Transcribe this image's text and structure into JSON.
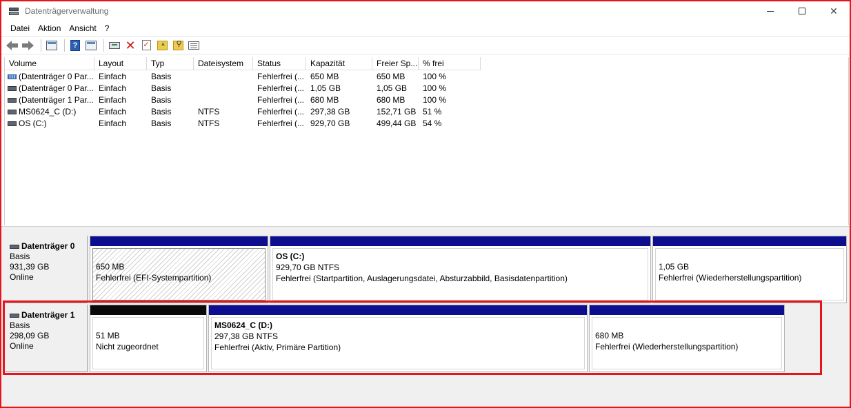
{
  "window": {
    "title": "Datenträgerverwaltung",
    "controls": {
      "minimize": "minimize",
      "maximize": "maximize",
      "close": "✕"
    }
  },
  "menu": [
    "Datei",
    "Aktion",
    "Ansicht",
    "?"
  ],
  "toolbar": {
    "icons": [
      "back-arrow-icon",
      "forward-arrow-icon",
      "console-tree-icon",
      "help-icon",
      "properties-icon",
      "connect-icon",
      "delete-icon",
      "check-icon",
      "folder-up-icon",
      "folder-search-icon",
      "list-view-icon"
    ]
  },
  "volume_list": {
    "columns": [
      "Volume",
      "Layout",
      "Typ",
      "Dateisystem",
      "Status",
      "Kapazität",
      "Freier Sp...",
      "% frei"
    ],
    "rows": [
      {
        "volume": "(Datenträger 0 Par...",
        "layout": "Einfach",
        "typ": "Basis",
        "dateisystem": "",
        "status": "Fehlerfrei (...",
        "kapazitaet": "650 MB",
        "frei": "650 MB",
        "prozent": "100 %",
        "icon": "striped"
      },
      {
        "volume": "(Datenträger 0 Par...",
        "layout": "Einfach",
        "typ": "Basis",
        "dateisystem": "",
        "status": "Fehlerfrei (...",
        "kapazitaet": "1,05 GB",
        "frei": "1,05 GB",
        "prozent": "100 %",
        "icon": "plain"
      },
      {
        "volume": "(Datenträger 1 Par...",
        "layout": "Einfach",
        "typ": "Basis",
        "dateisystem": "",
        "status": "Fehlerfrei (...",
        "kapazitaet": "680 MB",
        "frei": "680 MB",
        "prozent": "100 %",
        "icon": "plain"
      },
      {
        "volume": "MS0624_C (D:)",
        "layout": "Einfach",
        "typ": "Basis",
        "dateisystem": "NTFS",
        "status": "Fehlerfrei (...",
        "kapazitaet": "297,38 GB",
        "frei": "152,71 GB",
        "prozent": "51 %",
        "icon": "plain"
      },
      {
        "volume": "OS (C:)",
        "layout": "Einfach",
        "typ": "Basis",
        "dateisystem": "NTFS",
        "status": "Fehlerfrei (...",
        "kapazitaet": "929,70 GB",
        "frei": "499,44 GB",
        "prozent": "54 %",
        "icon": "plain"
      }
    ]
  },
  "disks": [
    {
      "name": "Datenträger 0",
      "type": "Basis",
      "size": "931,39 GB",
      "state": "Online",
      "partitions": [
        {
          "name": "",
          "line1": "650 MB",
          "line2": "Fehlerfrei (EFI-Systempartition)",
          "style": "hatched",
          "bar": "blue"
        },
        {
          "name": "OS  (C:)",
          "line1": "929,70 GB NTFS",
          "line2": "Fehlerfrei (Startpartition, Auslagerungsdatei, Absturzabbild, Basisdatenpartition)",
          "style": "normal",
          "bar": "blue"
        },
        {
          "name": "",
          "line1": "1,05 GB",
          "line2": "Fehlerfrei (Wiederherstellungspartition)",
          "style": "normal",
          "bar": "blue"
        }
      ]
    },
    {
      "name": "Datenträger 1",
      "type": "Basis",
      "size": "298,09 GB",
      "state": "Online",
      "partitions": [
        {
          "name": "",
          "line1": "51 MB",
          "line2": "Nicht zugeordnet",
          "style": "normal",
          "bar": "black"
        },
        {
          "name": "MS0624_C  (D:)",
          "line1": "297,38 GB NTFS",
          "line2": "Fehlerfrei (Aktiv, Primäre Partition)",
          "style": "normal",
          "bar": "blue"
        },
        {
          "name": "",
          "line1": "680 MB",
          "line2": "Fehlerfrei (Wiederherstellungspartition)",
          "style": "normal",
          "bar": "blue"
        }
      ]
    }
  ],
  "colors": {
    "partition_bar": "#0d0d8f",
    "unallocated_bar": "#0a0a0a",
    "highlight": "#e8141c"
  }
}
